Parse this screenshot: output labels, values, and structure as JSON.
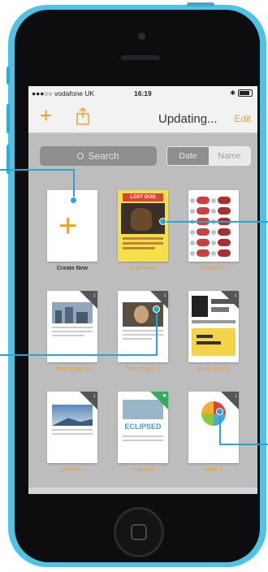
{
  "status": {
    "carrier": "●●●○○ vodafone UK",
    "wifi_icon": "wifi-icon",
    "time": "16:19",
    "bluetooth_icon": "bluetooth-icon"
  },
  "navbar": {
    "add_icon": "plus-icon",
    "share_icon": "share-icon",
    "title": "Updating...",
    "edit_label": "Edit"
  },
  "search": {
    "placeholder": "Search"
  },
  "sort": {
    "options": [
      "Date",
      "Name"
    ],
    "selected": "Date"
  },
  "documents": [
    {
      "label": "Create New"
    },
    {
      "label": "DogPoster",
      "thumb_text": "LOST DOG"
    },
    {
      "label": "Untitled 6"
    },
    {
      "label": "Term Paper 6"
    },
    {
      "label": "Term Paper 7"
    },
    {
      "label": "Music Poster"
    },
    {
      "label": "Untitled 4"
    },
    {
      "label": "Eclipsed",
      "thumb_text": "ECLIPSED"
    },
    {
      "label": "Blank 7"
    }
  ],
  "colors": {
    "accent": "#f0a030",
    "phone": "#4fc3e6",
    "callout": "#2aa4d4"
  }
}
